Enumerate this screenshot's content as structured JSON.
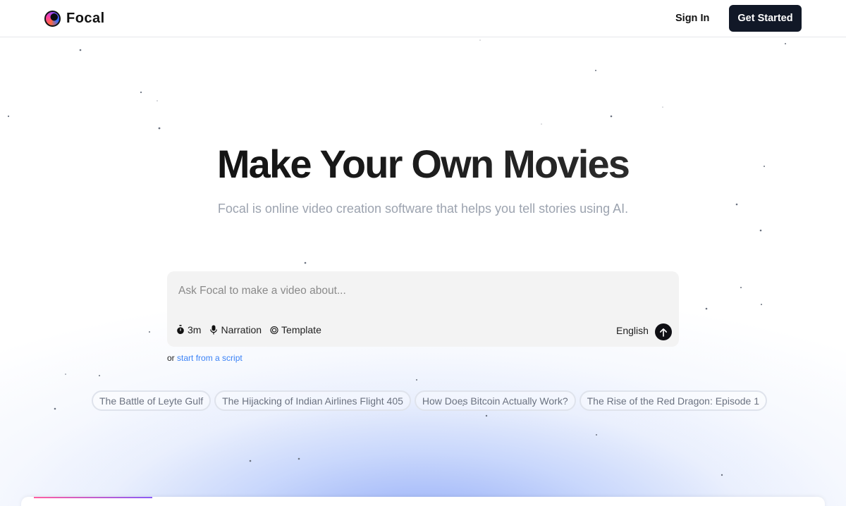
{
  "header": {
    "brand": "Focal",
    "signin_label": "Sign In",
    "get_started_label": "Get Started"
  },
  "hero": {
    "title": "Make Your Own Movies",
    "subtitle": "Focal is online video creation software that helps you tell stories using AI."
  },
  "prompt": {
    "placeholder": "Ask Focal to make a video about...",
    "value": "",
    "options": [
      {
        "icon": "stopwatch-icon",
        "label": "3m"
      },
      {
        "icon": "microphone-icon",
        "label": "Narration"
      },
      {
        "icon": "template-icon",
        "label": "Template"
      }
    ],
    "language": "English",
    "send_icon": "arrow-up-icon"
  },
  "script_link": {
    "prefix": "or",
    "link_text": "start from a script"
  },
  "suggestions": [
    "The Battle of Leyte Gulf",
    "The Hijacking of Indian Airlines Flight 405",
    "How Does Bitcoin Actually Work?",
    "The Rise of the Red Dragon: Episode 1"
  ],
  "colors": {
    "primary_button": "#111827",
    "link": "#3b82f6",
    "glow": "#8ca6f5"
  }
}
